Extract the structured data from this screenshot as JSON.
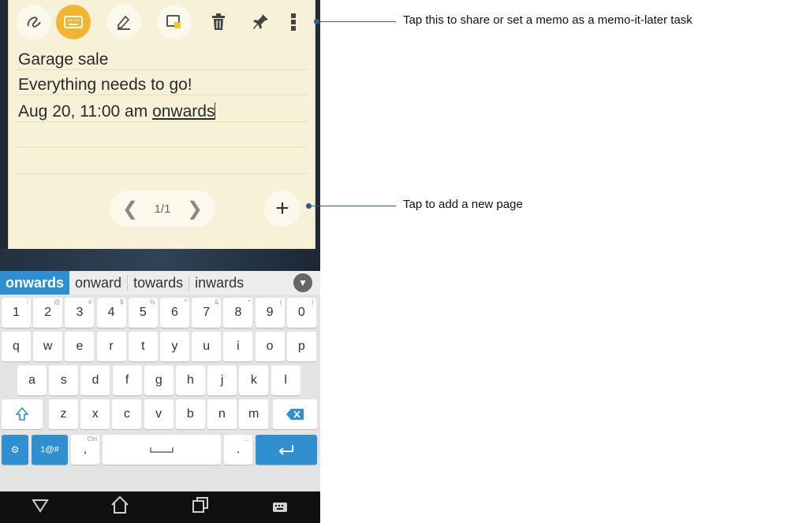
{
  "memo": {
    "lines": [
      "Garage sale",
      "Everything needs to go!",
      "Aug 20, 11:00 am ",
      "onwards"
    ],
    "pager": {
      "prev": "❮",
      "label": "1/1",
      "next": "❯"
    },
    "add_label": "+"
  },
  "toolbar": {
    "icons": [
      "handwriting-icon",
      "keyboard-icon",
      "pen-icon",
      "memo-color-icon",
      "trash-icon",
      "pin-icon",
      "more-icon"
    ],
    "active_color": "#f3b433"
  },
  "suggestions": [
    "onwards",
    "onward",
    "towards",
    "inwards"
  ],
  "keyboard": {
    "row1": [
      "1",
      "2",
      "3",
      "4",
      "5",
      "6",
      "7",
      "8",
      "9",
      "0"
    ],
    "row1_alt": [
      "!",
      "@",
      "#",
      "$",
      "%",
      "^",
      "&",
      "*",
      "(",
      ")"
    ],
    "row2": [
      "q",
      "w",
      "e",
      "r",
      "t",
      "y",
      "u",
      "i",
      "o",
      "p"
    ],
    "row3": [
      "a",
      "s",
      "d",
      "f",
      "g",
      "h",
      "j",
      "k",
      "l"
    ],
    "row4": [
      "z",
      "x",
      "c",
      "v",
      "b",
      "n",
      "m"
    ],
    "row5": {
      "sym": "1@#",
      "ctrl": "Ctrl",
      "comma": ",",
      "period": "."
    },
    "accent_color": "#2f8fcf"
  },
  "callouts": {
    "more": "Tap this to share or set a memo as a memo-it-later task",
    "add": "Tap to add a new page"
  }
}
